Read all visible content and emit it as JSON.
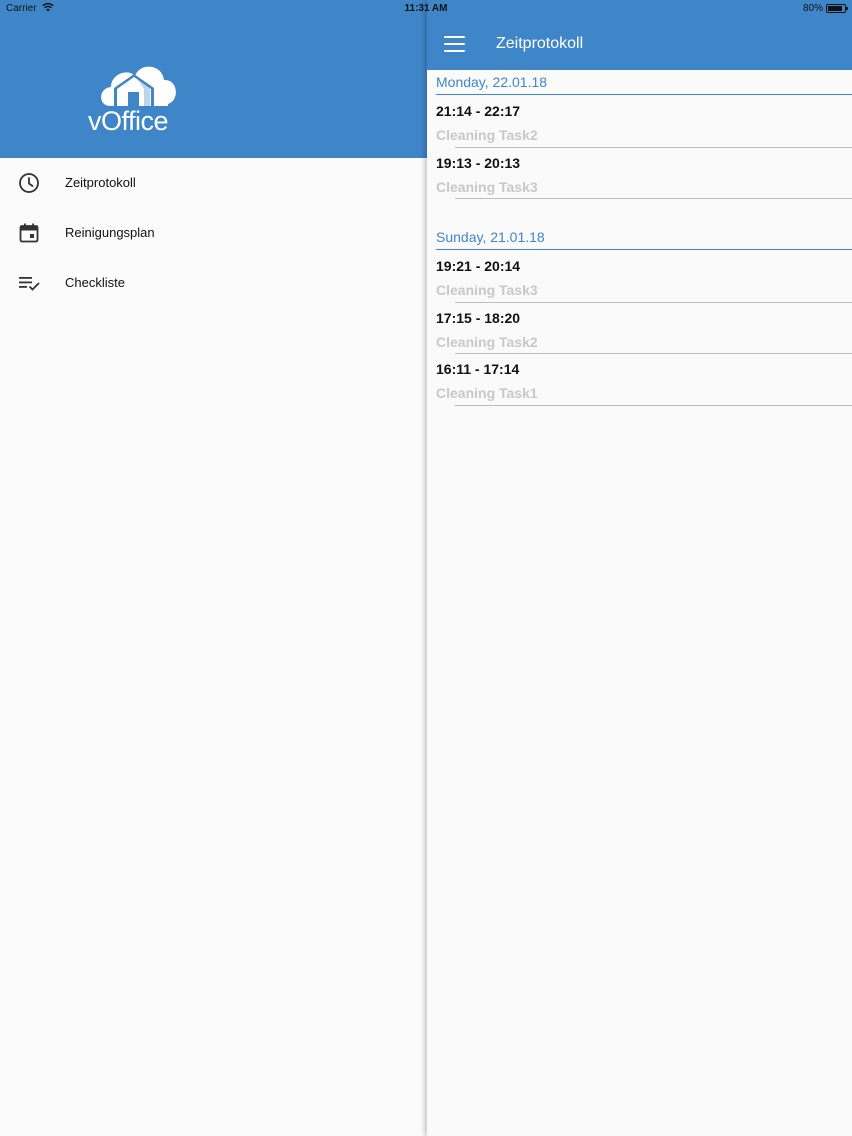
{
  "status_bar": {
    "carrier": "Carrier",
    "time": "11:31 AM",
    "battery": "80%",
    "battery_level": 0.8
  },
  "drawer": {
    "logo_text": "vOffice",
    "items": [
      {
        "label": "Zeitprotokoll",
        "icon": "clock-icon"
      },
      {
        "label": "Reinigungsplan",
        "icon": "calendar-icon"
      },
      {
        "label": "Checkliste",
        "icon": "checklist-icon"
      }
    ]
  },
  "appbar": {
    "title": "Zeitprotokoll",
    "menu_icon": "hamburger-icon"
  },
  "log": [
    {
      "date": "Monday, 22.01.18",
      "entries": [
        {
          "time": "21:14 - 22:17",
          "task": "Cleaning Task2"
        },
        {
          "time": "19:13 - 20:13",
          "task": "Cleaning Task3"
        }
      ]
    },
    {
      "date": "Sunday, 21.01.18",
      "entries": [
        {
          "time": "19:21 - 20:14",
          "task": "Cleaning Task3"
        },
        {
          "time": "17:15 - 18:20",
          "task": "Cleaning Task2"
        },
        {
          "time": "16:11 - 17:14",
          "task": "Cleaning Task1"
        }
      ]
    }
  ],
  "colors": {
    "primary": "#3f86c9",
    "task_text": "#c8c8c8"
  }
}
